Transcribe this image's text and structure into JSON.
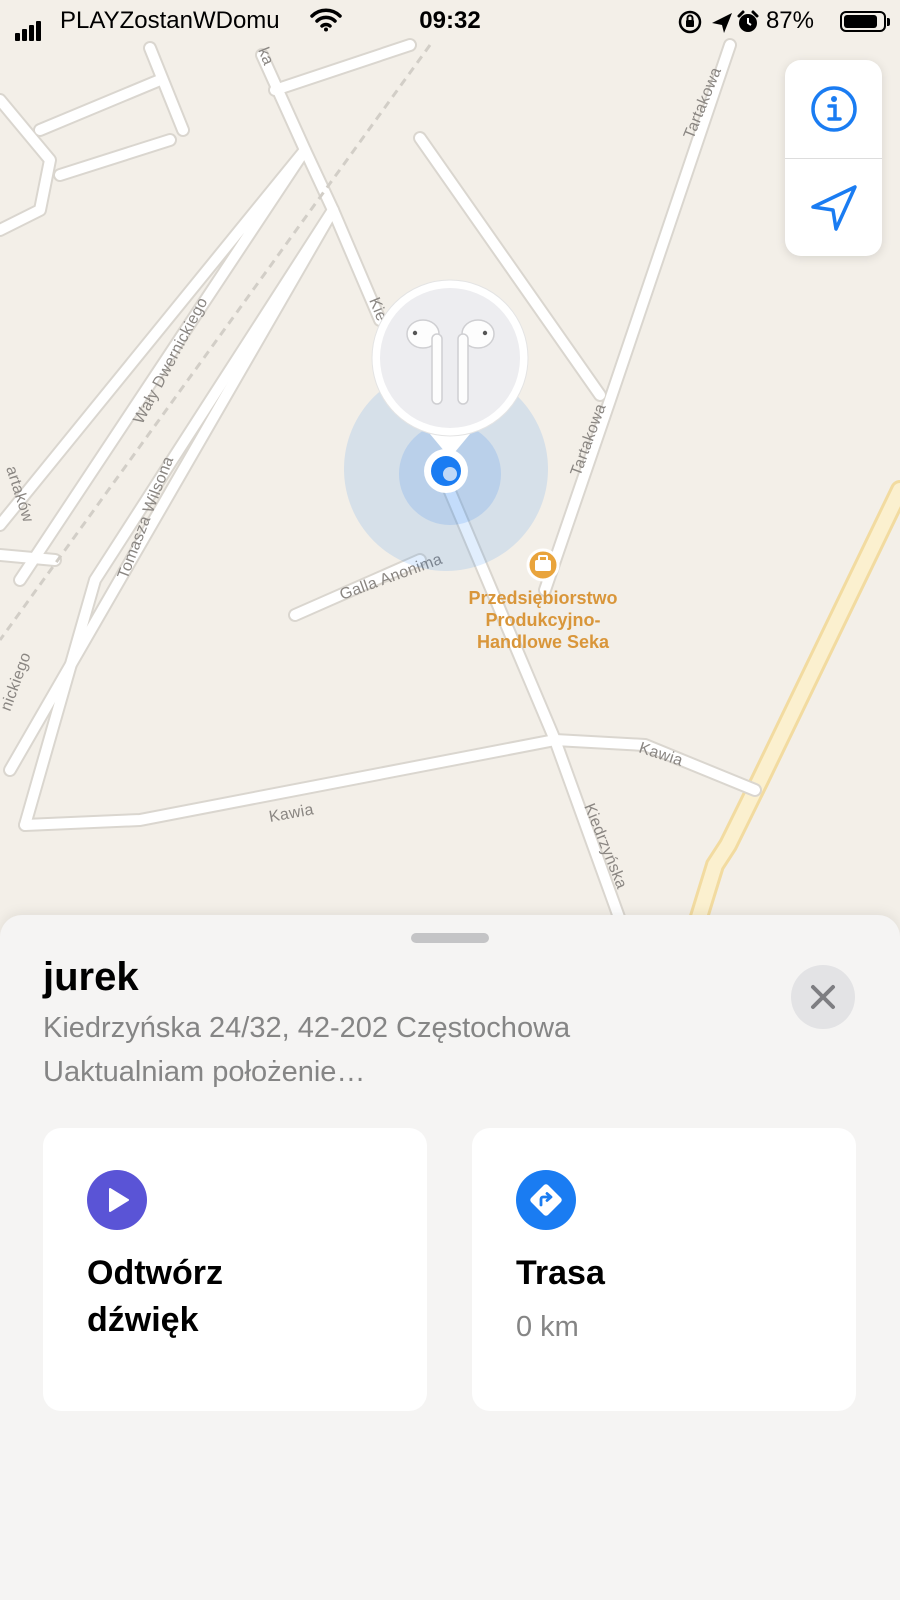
{
  "status_bar": {
    "carrier": "PLAYZostanWDomu",
    "time": "09:32",
    "battery_percent": "87%",
    "battery_level": 0.87,
    "icons": [
      "signal-icon",
      "wifi-icon",
      "orientation-lock-icon",
      "location-arrow-icon",
      "alarm-icon",
      "battery-icon"
    ]
  },
  "map": {
    "street_labels": {
      "waly_dwernickiego": "Wały Dwernickiego",
      "tomasza_wilsona": "Tomasza Wilsona",
      "tartakowa_top": "Tartakowa",
      "tartakowa_mid": "Tartakowa",
      "galla_anonima": "Galla Anonima",
      "kawia_left": "Kawia",
      "kawia_right": "Kawia",
      "kiedrzynska_bottom": "Kiedrzyńska",
      "kiedrzynska_top": "Kie",
      "partial_top": "ka",
      "partial_left": "artaków",
      "partial_left_bottom": "nickiego"
    },
    "poi": {
      "line1": "Przedsiębiorstwo",
      "line2": "Produkcyjno-",
      "line3": "Handlowe Seka",
      "icon": "briefcase-icon",
      "color": "#e9a43c"
    },
    "device_marker_icon": "airpods-icon",
    "accent_color": "#1a7cf2"
  },
  "map_controls": {
    "info_icon": "info-icon",
    "location_icon": "location-arrow-icon"
  },
  "sheet": {
    "device_name": "jurek",
    "address": "Kiedrzyńska 24/32, 42-202 Częstochowa",
    "status": "Uaktualniam położenie…",
    "close_icon": "close-icon",
    "actions": [
      {
        "title_line1": "Odtwórz",
        "title_line2": "dźwięk",
        "icon": "play-icon",
        "color": "#5a54d6"
      },
      {
        "title": "Trasa",
        "subtitle": "0 km",
        "icon": "directions-icon",
        "color": "#1a7cf2"
      }
    ]
  }
}
